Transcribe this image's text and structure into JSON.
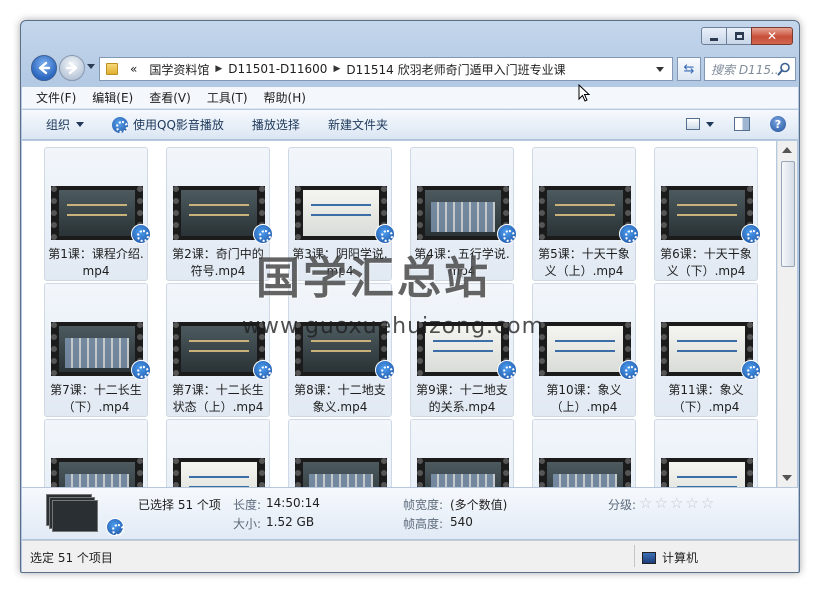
{
  "window": {
    "caption_buttons": {
      "minimize": "",
      "maximize": "",
      "close": "✕"
    }
  },
  "nav": {
    "breadcrumb_overflow": "«",
    "breadcrumbs": [
      "国学资料馆",
      "D11501-D11600",
      "D11514 欣羽老师奇门遁甲入门班专业课"
    ],
    "search_placeholder": "搜索 D115..."
  },
  "menu": [
    "文件(F)",
    "编辑(E)",
    "查看(V)",
    "工具(T)",
    "帮助(H)"
  ],
  "commands": {
    "organize": "组织",
    "play_qq": "使用QQ影音播放",
    "play_selection": "播放选择",
    "new_folder": "新建文件夹"
  },
  "files": [
    {
      "name": "第1课：课程介绍.mp4",
      "thumb": "dark"
    },
    {
      "name": "第2课：奇门中的符号.mp4",
      "thumb": "dark"
    },
    {
      "name": "第3课：阴阳学说.mp4",
      "thumb": "light"
    },
    {
      "name": "第4课：五行学说.mp4",
      "thumb": "grid"
    },
    {
      "name": "第5课：十天干象义（上）.mp4",
      "thumb": "dark"
    },
    {
      "name": "第6课：十天干象义（下）.mp4",
      "thumb": "dark"
    },
    {
      "name": "第7课：十二长生（下）.mp4",
      "thumb": "grid"
    },
    {
      "name": "第7课：十二长生状态（上）.mp4",
      "thumb": "dark"
    },
    {
      "name": "第8课：十二地支象义.mp4",
      "thumb": "dark"
    },
    {
      "name": "第9课：十二地支的关系.mp4",
      "thumb": "light"
    },
    {
      "name": "第10课：象义（上）.mp4",
      "thumb": "light"
    },
    {
      "name": "第11课：象义（下）.mp4",
      "thumb": "light"
    },
    {
      "name": "",
      "thumb": "grid"
    },
    {
      "name": "",
      "thumb": "light"
    },
    {
      "name": "",
      "thumb": "grid"
    },
    {
      "name": "",
      "thumb": "grid"
    },
    {
      "name": "",
      "thumb": "grid"
    },
    {
      "name": "",
      "thumb": "light"
    }
  ],
  "details": {
    "selected": "已选择 51 个项",
    "length_label": "长度:",
    "length_value": "14:50:14",
    "size_label": "大小:",
    "size_value": "1.52 GB",
    "frame_width_label": "帧宽度:",
    "frame_width_value": "(多个数值)",
    "frame_height_label": "帧高度:",
    "frame_height_value": "540",
    "rating_label": "分级:",
    "rating_stars": 0
  },
  "status": {
    "selection": "选定 51 个项目",
    "location": "计算机"
  },
  "watermark": {
    "title": "国学汇总站",
    "url": "www.guoxuehuizong.com"
  }
}
